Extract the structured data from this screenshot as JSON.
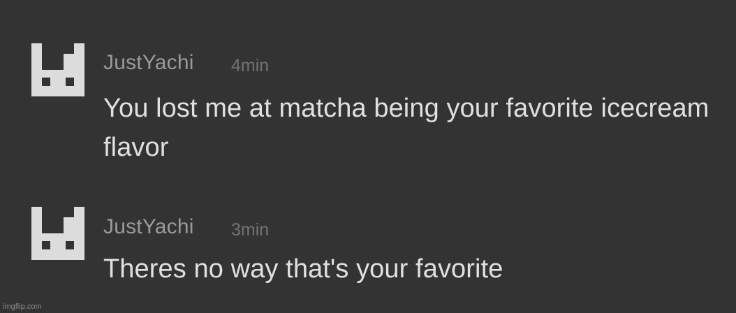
{
  "comments": [
    {
      "avatar_icon": "blocky-robot-avatar-icon",
      "username": "JustYachi",
      "timestamp": "4min",
      "message": "You lost me at matcha being your favorite icecream flavor"
    },
    {
      "avatar_icon": "blocky-robot-avatar-icon",
      "username": "JustYachi",
      "timestamp": "3min",
      "message": "Theres no way that's your favorite"
    }
  ],
  "watermark": "imgflip.com",
  "colors": {
    "background": "#333333",
    "avatar": "#dcdcdc",
    "username": "#9a9a9a",
    "timestamp": "#727272",
    "message": "#e0e0e0"
  }
}
